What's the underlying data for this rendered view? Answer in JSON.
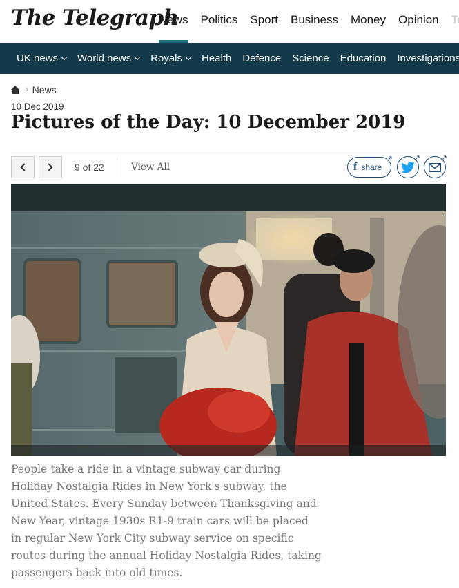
{
  "brand": {
    "logo": "The Telegraph"
  },
  "top_nav": [
    {
      "label": "News",
      "active": true
    },
    {
      "label": "Politics"
    },
    {
      "label": "Sport"
    },
    {
      "label": "Business"
    },
    {
      "label": "Money"
    },
    {
      "label": "Opinion"
    },
    {
      "label": "Te",
      "faded": true
    }
  ],
  "sub_nav": [
    {
      "label": "UK news",
      "dropdown": true
    },
    {
      "label": "World news",
      "dropdown": true
    },
    {
      "label": "Royals",
      "dropdown": true
    },
    {
      "label": "Health"
    },
    {
      "label": "Defence"
    },
    {
      "label": "Science"
    },
    {
      "label": "Education"
    },
    {
      "label": "Investigations",
      "dropdown": true
    }
  ],
  "breadcrumb": {
    "section": "News"
  },
  "article": {
    "date": "10 Dec 2019",
    "title": "Pictures of the Day: 10 December 2019"
  },
  "gallery": {
    "counter": "9 of 22",
    "view_all": "View All",
    "share_label": "share",
    "caption": "People take a ride in a vintage subway car during Holiday Nostalgia Rides in New York's subway, the United States. Every Sunday between Thanksgiving and New Year, vintage 1930s R1-9 train cars will be placed in regular New York City subway service on specific routes during the annual Holiday Nostalgia Rides, taking passengers back into old times."
  },
  "colors": {
    "subnav_bg": "#123a4b",
    "active_underline": "#1a6b75",
    "share_blue": "#1a4b7a",
    "twitter_blue": "#1da1f2"
  },
  "icons": [
    "home-icon",
    "chevron-left-icon",
    "chevron-right-icon",
    "facebook-icon",
    "twitter-icon",
    "email-icon",
    "external-link-icon"
  ]
}
